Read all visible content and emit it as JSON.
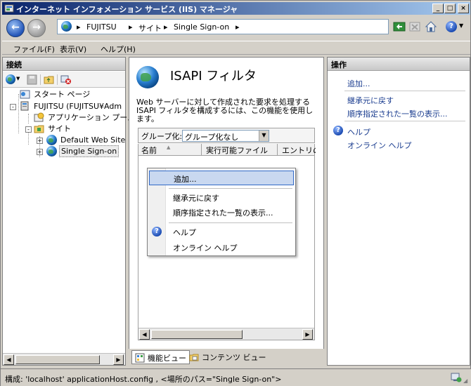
{
  "window": {
    "title": "インターネット インフォメーション サービス (IIS) マネージャ",
    "controls": {
      "minimize": "_",
      "maximize": "□",
      "close": "×"
    }
  },
  "address": {
    "segments": [
      "FUJITSU",
      "サイト",
      "Single Sign-on"
    ],
    "separator": "▸"
  },
  "menu": [
    "ファイル(F)",
    "表示(V)",
    "ヘルプ(H)"
  ],
  "connections": {
    "header": "接続",
    "tree": [
      {
        "label": "スタート ページ",
        "icon": "start-page-icon"
      },
      {
        "label": "FUJITSU (FUJITSU¥Adm",
        "icon": "server-icon",
        "expander": "-"
      },
      {
        "label": "アプリケーション プール",
        "icon": "app-pool-icon"
      },
      {
        "label": "サイト",
        "icon": "folder-icon",
        "expander": "-"
      },
      {
        "label": "Default Web Site",
        "icon": "globe-icon",
        "expander": "+"
      },
      {
        "label": "Single Sign-on",
        "icon": "globe-icon",
        "expander": "+",
        "selected": true
      }
    ]
  },
  "feature": {
    "title": "ISAPI フィルタ",
    "description": "Web サーバーに対して作成された要求を処理する ISAPI フィルタを構成するには、この機能を使用します。",
    "group_label": "グループ化:",
    "group_value": "グループ化なし",
    "columns": [
      "名前",
      "実行可能ファイル",
      "エントリの"
    ]
  },
  "view_tabs": {
    "features": "機能ビュー",
    "content": "コンテンツ ビュー"
  },
  "actions": {
    "header": "操作",
    "items": [
      "追加...",
      "継承元に戻す",
      "順序指定された一覧の表示...",
      "ヘルプ",
      "オンライン ヘルプ"
    ]
  },
  "context_menu": {
    "items": [
      "追加...",
      "継承元に戻す",
      "順序指定された一覧の表示...",
      "ヘルプ",
      "オンライン ヘルプ"
    ]
  },
  "status": {
    "text": "構成: 'localhost' applicationHost.config , <場所のパス=\"Single Sign-on\">"
  },
  "colors": {
    "accent": "#0a246a",
    "link": "#1a3c8f",
    "highlight": "#c9d8f0"
  }
}
